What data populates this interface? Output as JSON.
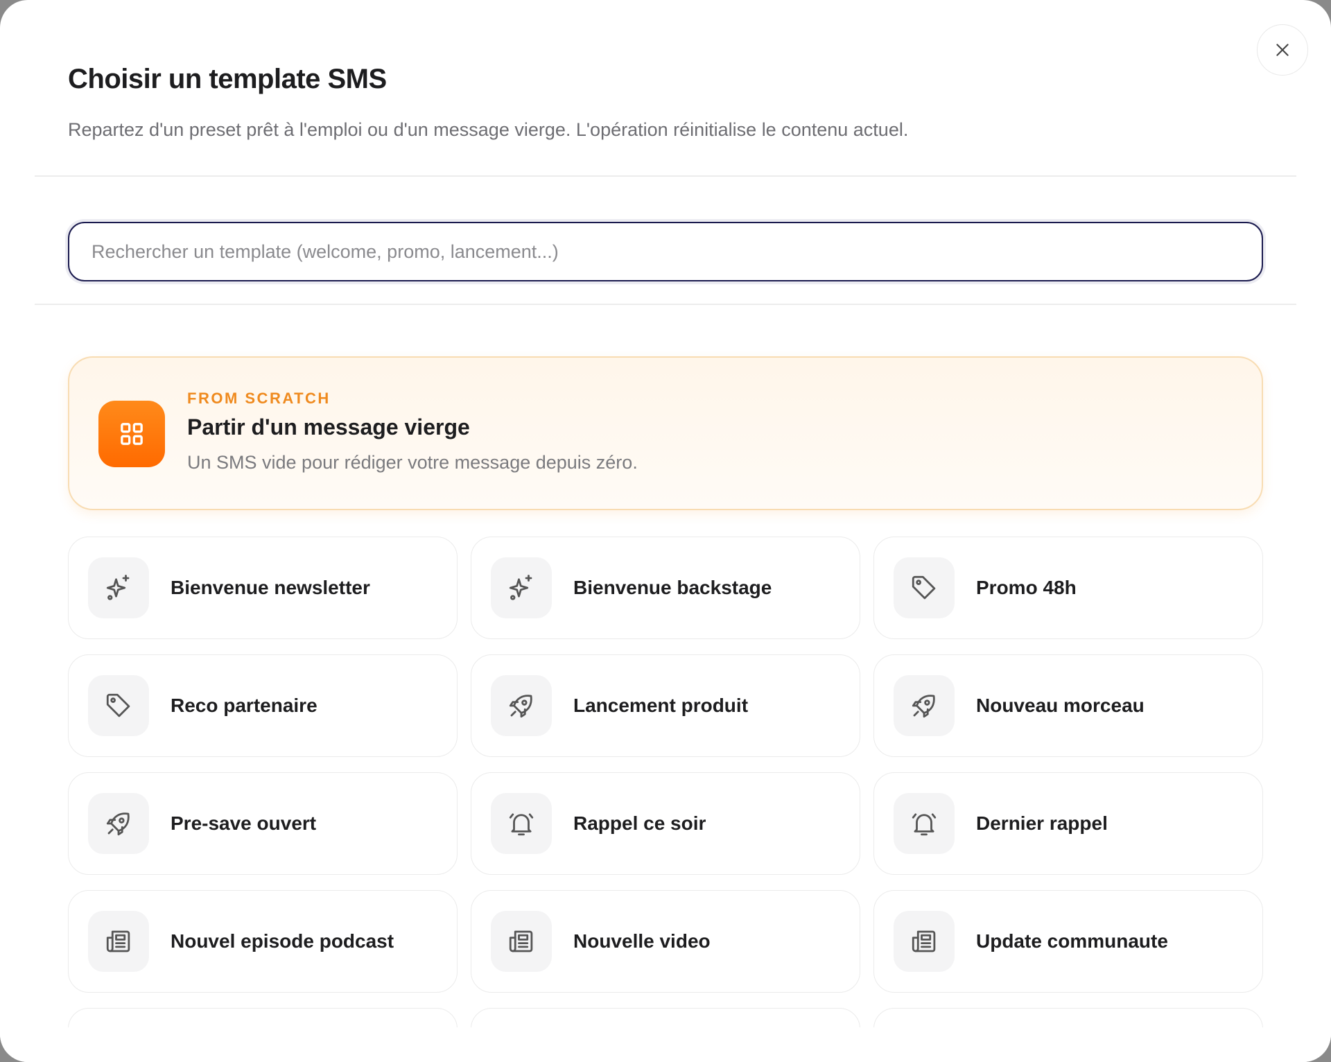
{
  "modal": {
    "title": "Choisir un template SMS",
    "subtitle": "Repartez d'un preset prêt à l'emploi ou d'un message vierge. L'opération réinitialise le contenu actuel.",
    "close_icon": "close-icon"
  },
  "search": {
    "placeholder": "Rechercher un template (welcome, promo, lancement...)",
    "value": ""
  },
  "scratch": {
    "tag": "FROM SCRATCH",
    "title": "Partir d'un message vierge",
    "description": "Un SMS vide pour rédiger votre message depuis zéro.",
    "icon": "grid-icon",
    "accent": "#ff7a00"
  },
  "templates": [
    {
      "label": "Bienvenue newsletter",
      "icon": "sparkles-icon"
    },
    {
      "label": "Bienvenue backstage",
      "icon": "sparkles-icon"
    },
    {
      "label": "Promo 48h",
      "icon": "tag-icon"
    },
    {
      "label": "Reco partenaire",
      "icon": "tag-icon"
    },
    {
      "label": "Lancement produit",
      "icon": "rocket-icon"
    },
    {
      "label": "Nouveau morceau",
      "icon": "rocket-icon"
    },
    {
      "label": "Pre-save ouvert",
      "icon": "rocket-icon"
    },
    {
      "label": "Rappel ce soir",
      "icon": "bell-icon"
    },
    {
      "label": "Dernier rappel",
      "icon": "bell-icon"
    },
    {
      "label": "Nouvel episode podcast",
      "icon": "newspaper-icon"
    },
    {
      "label": "Nouvelle video",
      "icon": "newspaper-icon"
    },
    {
      "label": "Update communaute",
      "icon": "newspaper-icon"
    }
  ]
}
